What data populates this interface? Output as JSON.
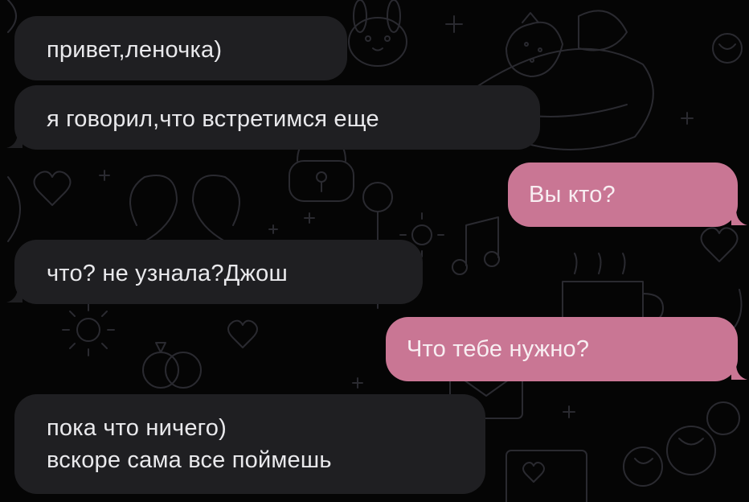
{
  "colors": {
    "background": "#050505",
    "incoming_bubble": "#1f1f22",
    "outgoing_bubble": "#c97694",
    "incoming_text": "#e9e9ec",
    "outgoing_text": "#f8eef2",
    "wallpaper_doodle": "#2a2a30"
  },
  "wallpaper": {
    "icons": [
      "heart-icon",
      "bunny-icon",
      "strawberry-icon",
      "cake-icon",
      "swans-icon",
      "key-icon",
      "lock-icon",
      "music-note-icon",
      "rings-icon",
      "coffee-cup-icon",
      "flowers-icon",
      "sparkle-icon",
      "envelope-icon",
      "photo-frame-icon"
    ]
  },
  "messages": [
    {
      "side": "incoming",
      "lines": [
        "привет,леночка)"
      ]
    },
    {
      "side": "incoming",
      "lines": [
        "я говорил,что встретимся еще"
      ]
    },
    {
      "side": "outgoing",
      "lines": [
        "Вы кто?"
      ]
    },
    {
      "side": "incoming",
      "lines": [
        "что? не узнала?Джош"
      ]
    },
    {
      "side": "outgoing",
      "lines": [
        "Что тебе нужно?"
      ]
    },
    {
      "side": "incoming",
      "lines": [
        "пока что ничего)",
        "вскоре сама все поймешь"
      ]
    }
  ]
}
